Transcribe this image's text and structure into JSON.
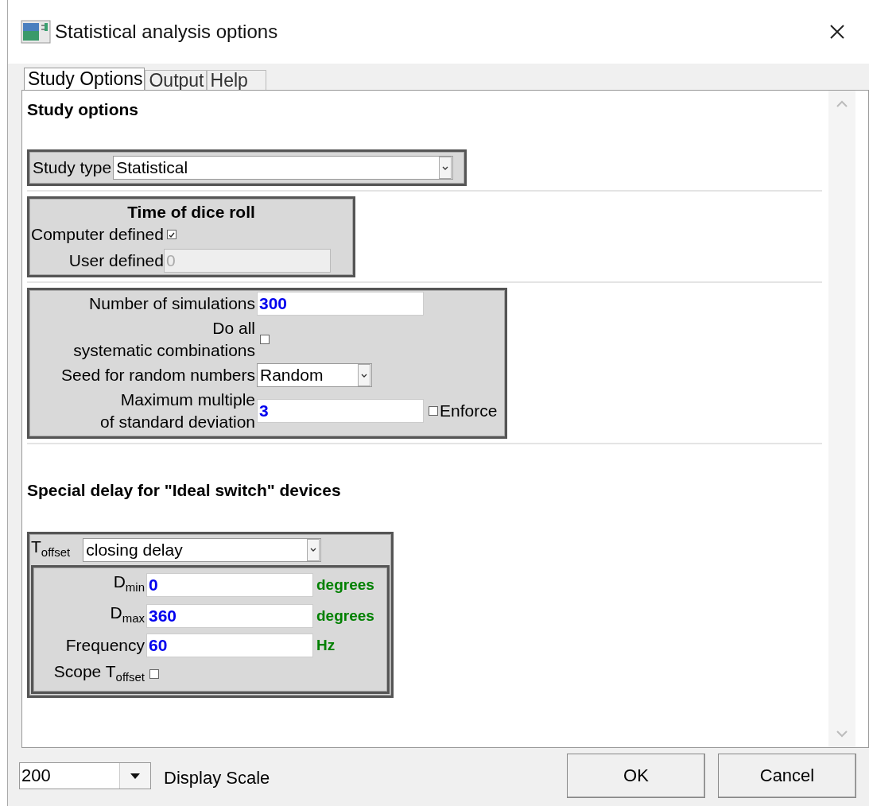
{
  "window": {
    "title": "Statistical analysis options"
  },
  "tabs": [
    {
      "label": "Study Options",
      "selected": true
    },
    {
      "label": "Output",
      "selected": false
    },
    {
      "label": "Help",
      "selected": false
    }
  ],
  "study_options": {
    "heading": "Study options",
    "study_type": {
      "label": "Study type",
      "value": "Statistical"
    },
    "dice_roll": {
      "title": "Time of dice roll",
      "rows": [
        {
          "kind": "checkbox",
          "label": "Computer defined",
          "checked": true
        },
        {
          "kind": "field",
          "label": "User defined",
          "value": "0",
          "disabled": true
        }
      ]
    },
    "simulation": {
      "rows": [
        {
          "kind": "field",
          "label": "Number of simulations",
          "value": "300",
          "disabled": false
        },
        {
          "kind": "checkbox",
          "label": "Do all\nsystematic combinations",
          "checked": false
        },
        {
          "kind": "select",
          "label": "Seed for random numbers",
          "value": "Random"
        },
        {
          "kind": "field",
          "label": "Maximum multiple\nof standard deviation",
          "value": "3",
          "disabled": false,
          "extra": {
            "label": "Enforce",
            "checked": false
          }
        }
      ]
    }
  },
  "special_delay": {
    "heading": "Special delay for \"Ideal switch\" devices",
    "toffset": {
      "label": "T$_{offset}$",
      "value": "closing delay"
    },
    "rows": [
      {
        "kind": "field",
        "label": "D$_{min}$",
        "value": "0",
        "unit": "degrees"
      },
      {
        "kind": "field",
        "label": "D$_{max}$",
        "value": "360",
        "unit": "degrees"
      },
      {
        "kind": "field",
        "label": "Frequency",
        "value": "60",
        "unit": "Hz"
      },
      {
        "kind": "checkbox",
        "label": "Scope T$_{offset}$",
        "checked": false
      }
    ]
  },
  "footer": {
    "scale": {
      "value": "200",
      "label": "Display Scale"
    },
    "buttons": [
      "OK",
      "Cancel"
    ]
  }
}
